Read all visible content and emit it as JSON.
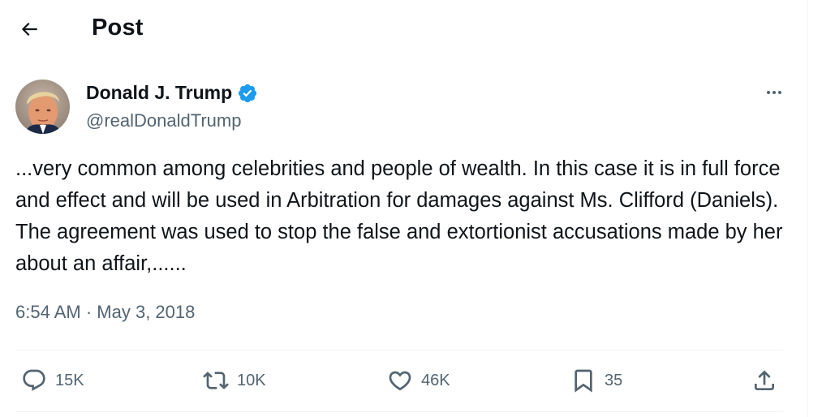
{
  "header": {
    "title": "Post",
    "back_icon": "arrow-left-icon"
  },
  "author": {
    "name": "Donald J. Trump",
    "handle": "@realDonaldTrump",
    "verified_icon": "verified-badge-icon",
    "verified_color": "#1d9bf0"
  },
  "tweet": {
    "text": "...very common among celebrities and people of wealth. In this case it is in full force and effect and will be used in Arbitration for damages against Ms. Clifford (Daniels). The agreement was used to stop the false and extortionist accusations made by her about an affair,......",
    "time": "6:54 AM",
    "separator": "·",
    "date": "May 3, 2018"
  },
  "actions": {
    "replies": {
      "icon": "reply-icon",
      "count": "15K"
    },
    "reposts": {
      "icon": "repost-icon",
      "count": "10K"
    },
    "likes": {
      "icon": "heart-icon",
      "count": "46K"
    },
    "bookmarks": {
      "icon": "bookmark-icon",
      "count": "35"
    },
    "share": {
      "icon": "share-icon"
    }
  },
  "more_icon": "more-horizontal-icon"
}
